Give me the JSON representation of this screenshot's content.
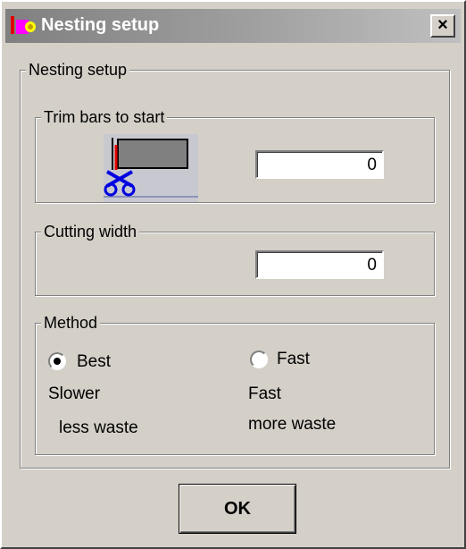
{
  "window": {
    "title": "Nesting setup",
    "close_glyph": "×"
  },
  "outer_group": {
    "label": "Nesting setup"
  },
  "trim": {
    "label": "Trim bars to start",
    "value": "0",
    "icon": "trim-bar-scissors-icon"
  },
  "cutting": {
    "label": "Cutting width",
    "value": "0"
  },
  "method": {
    "label": "Method",
    "selected": "best",
    "best": {
      "label": "Best",
      "desc1": "Slower",
      "desc2": "less waste"
    },
    "fast": {
      "label": "Fast",
      "desc1": "Fast",
      "desc2": "more waste"
    }
  },
  "ok_label": "OK",
  "colors": {
    "titlebar": "#808080",
    "face": "#d4d0c8"
  }
}
